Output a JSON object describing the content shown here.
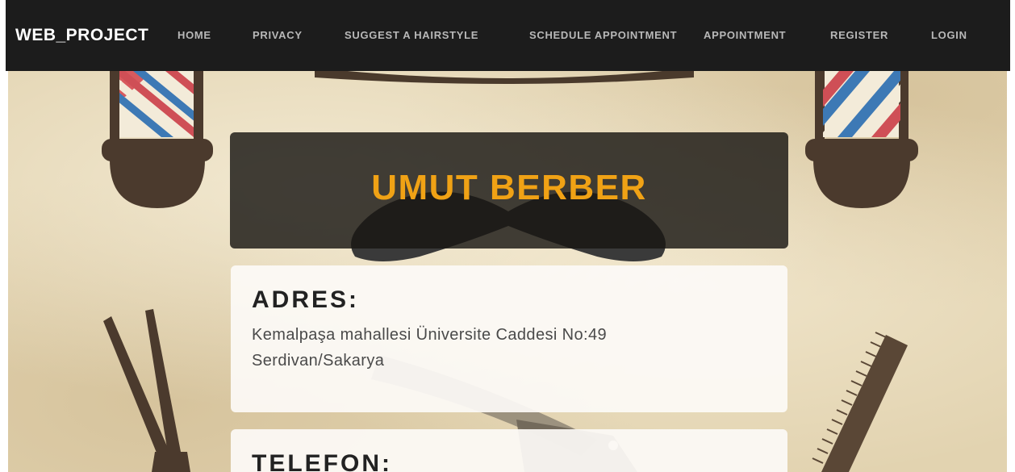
{
  "navbar": {
    "brand": "WEB_PROJECT",
    "links": [
      {
        "label": "HOME"
      },
      {
        "label": "PRIVACY"
      },
      {
        "label": "SUGGEST A HAIRSTYLE"
      },
      {
        "label": "SCHEDULE APPOINTMENT"
      },
      {
        "label": "APPOINTMENT"
      },
      {
        "label": "REGISTER"
      },
      {
        "label": "LOGIN"
      }
    ]
  },
  "hero": {
    "title": "UMUT BERBER"
  },
  "address_card": {
    "heading": "ADRES:",
    "lines": [
      "Kemalpaşa mahallesi Üniversite Caddesi No:49",
      "Serdivan/Sakarya"
    ]
  },
  "phone_card": {
    "heading": "TELEFON:"
  },
  "colors": {
    "navbar_bg": "#1c1c1c",
    "title_accent": "#f0a215",
    "background": "#e2d3b0"
  },
  "icons": [
    "barber-pole-icon",
    "mustache-icon",
    "scissors-icon",
    "razor-icon",
    "comb-icon"
  ]
}
